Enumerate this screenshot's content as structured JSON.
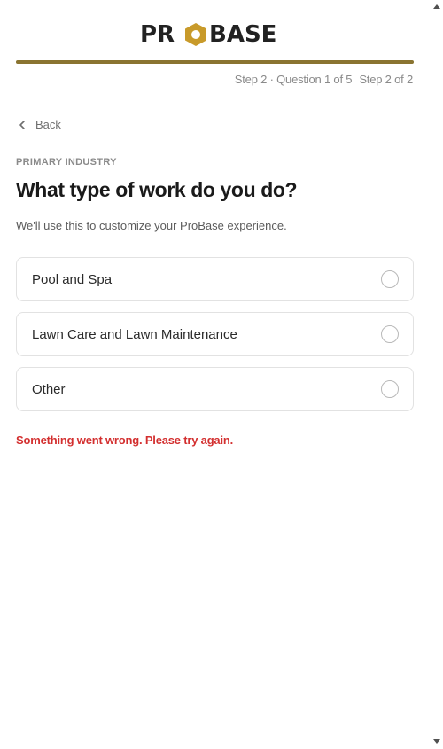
{
  "header": {
    "logo_text": "PROBASE",
    "logo_icon": "hexagon-o-icon",
    "brand_color": "#8a7431",
    "logo_dark_color": "#222222"
  },
  "progress": {
    "fraction": 1.0,
    "step_question": "Step 2 · Question 1 of 5",
    "step_of": "Step 2 of 2"
  },
  "nav": {
    "back_label": "Back",
    "back_icon": "chevron-left-icon"
  },
  "question": {
    "eyebrow": "PRIMARY INDUSTRY",
    "title": "What type of work do you do?",
    "subtitle": "We'll use this to customize your ProBase experience.",
    "options": [
      {
        "label": "Pool and Spa",
        "selected": false
      },
      {
        "label": "Lawn Care and Lawn Maintenance",
        "selected": false
      },
      {
        "label": "Other",
        "selected": false
      }
    ]
  },
  "error": {
    "message": "Something went wrong. Please try again.",
    "color": "#d32f2f"
  }
}
